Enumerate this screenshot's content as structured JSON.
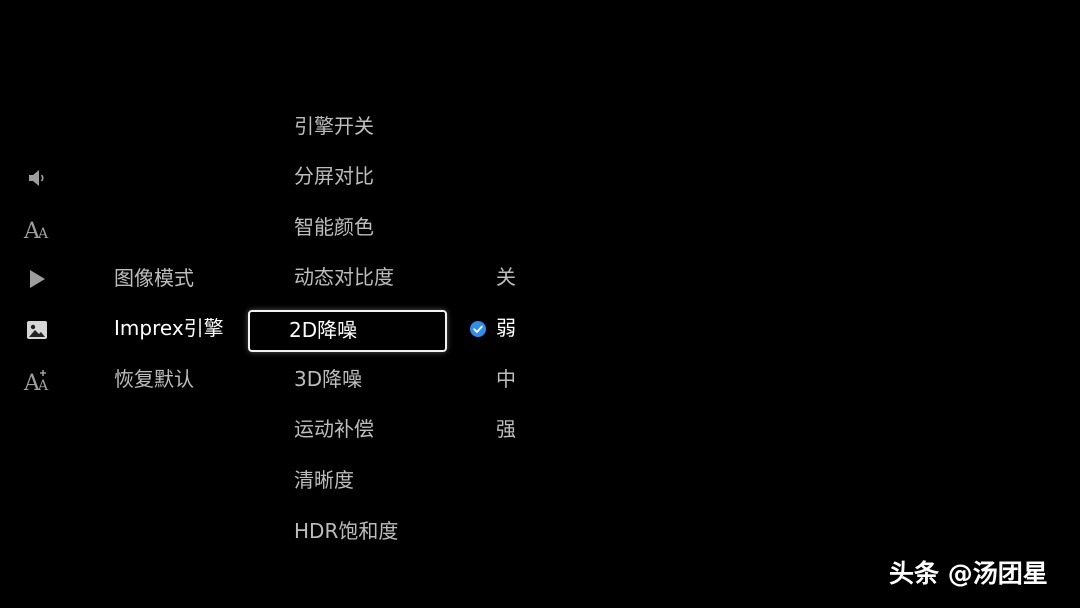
{
  "sidebar_icons": [
    "volume-icon",
    "font-size-icon",
    "play-icon",
    "picture-icon",
    "font-plus-icon"
  ],
  "submenu": {
    "items": [
      {
        "label": "图像模式"
      },
      {
        "label": "Imprex引擎"
      },
      {
        "label": "恢复默认"
      }
    ]
  },
  "options": {
    "items": [
      {
        "label": "引擎开关"
      },
      {
        "label": "分屏对比"
      },
      {
        "label": "智能颜色"
      },
      {
        "label": "动态对比度"
      },
      {
        "label": "2D降噪"
      },
      {
        "label": "3D降噪"
      },
      {
        "label": "运动补偿"
      },
      {
        "label": "清晰度"
      },
      {
        "label": "HDR饱和度"
      }
    ]
  },
  "values": {
    "items": [
      {
        "label": "关"
      },
      {
        "label": "弱"
      },
      {
        "label": "中"
      },
      {
        "label": "强"
      }
    ]
  },
  "watermark": "头条 @汤团星",
  "colors": {
    "background": "#000000",
    "text": "#bdbdbd",
    "active": "#ffffff",
    "check": "#2d8ef0"
  }
}
